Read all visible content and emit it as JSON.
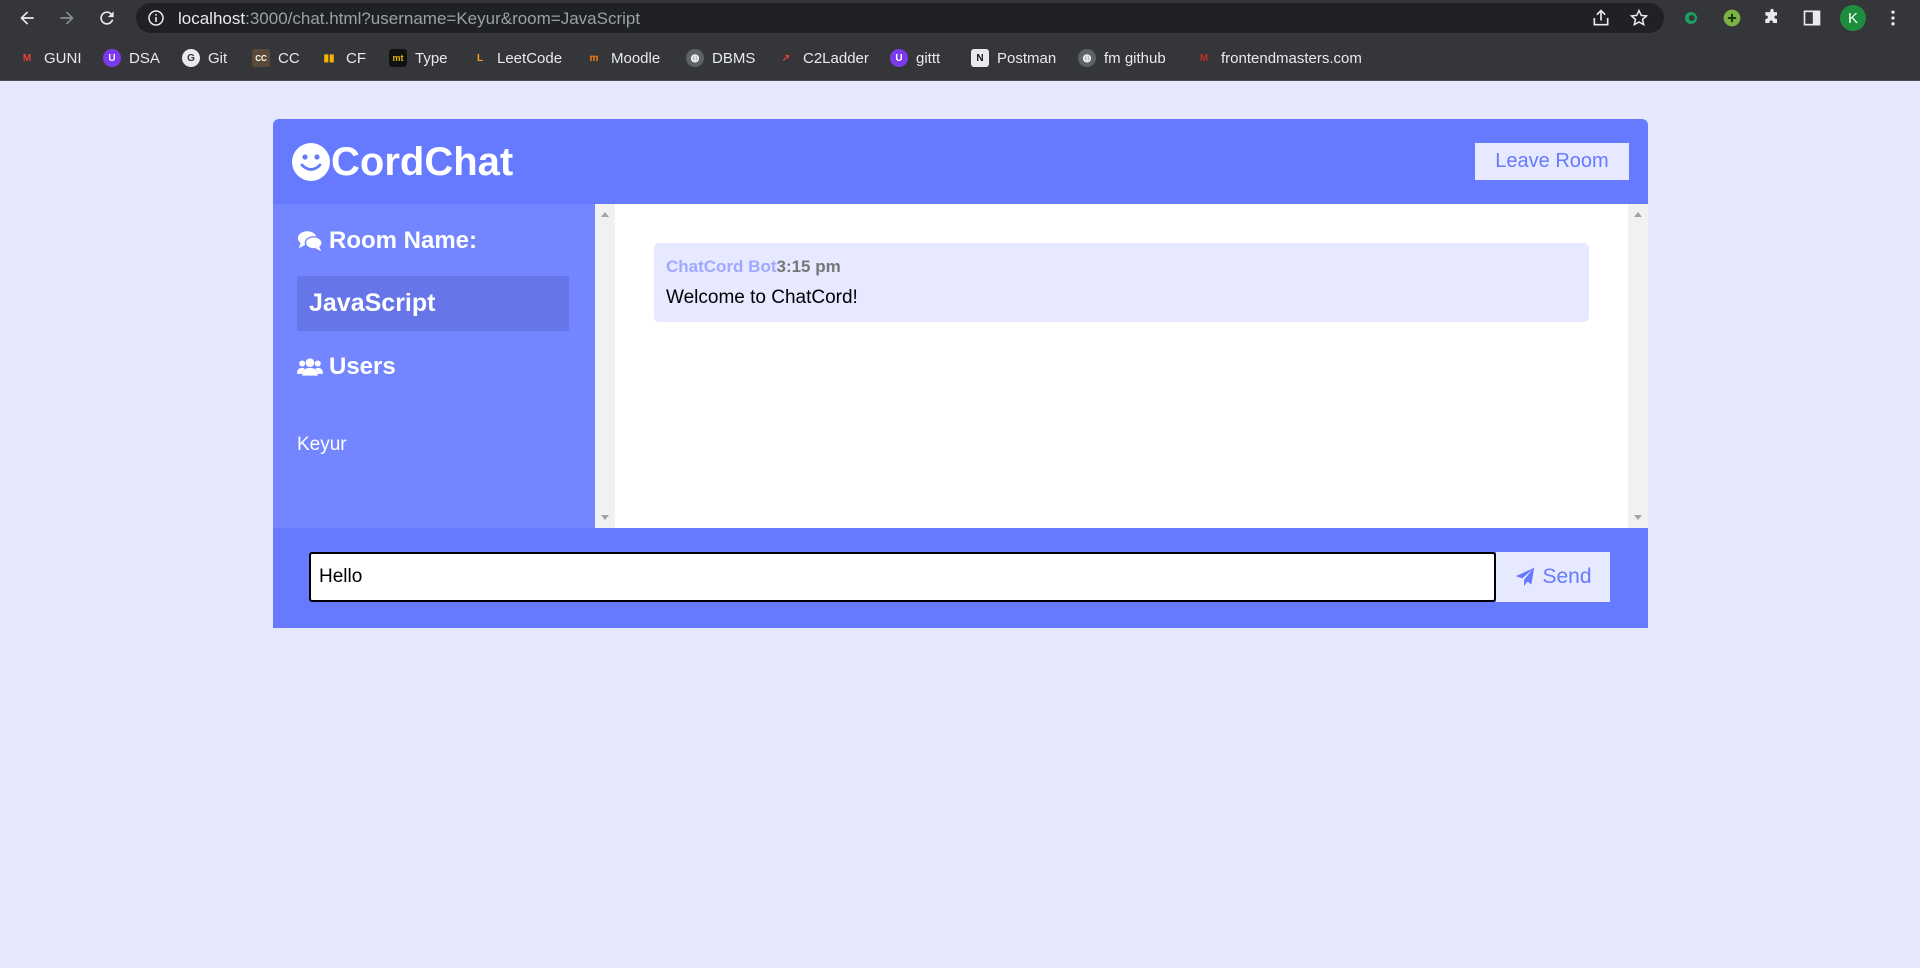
{
  "browser": {
    "url_host": "localhost",
    "url_rest": ":3000/chat.html?username=Keyur&room=JavaScript",
    "profile_initial": "K",
    "bookmarks": [
      {
        "label": "GUNI",
        "color": "#ea4335",
        "glyph": "M"
      },
      {
        "label": "DSA",
        "color": "#7c3aed",
        "glyph": "U"
      },
      {
        "label": "Git",
        "color": "#35363a",
        "glyph": "G"
      },
      {
        "label": "CC",
        "color": "#5b4a3a",
        "glyph": "CC"
      },
      {
        "label": "CF",
        "color": "#1a73e8",
        "glyph": "▮"
      },
      {
        "label": "Type",
        "color": "#111111",
        "glyph": "mt"
      },
      {
        "label": "LeetCode",
        "color": "#35363a",
        "glyph": "L"
      },
      {
        "label": "Moodle",
        "color": "#f98012",
        "glyph": "m"
      },
      {
        "label": "DBMS",
        "color": "#5f6368",
        "glyph": "◍"
      },
      {
        "label": "C2Ladder",
        "color": "#35363a",
        "glyph": "↗"
      },
      {
        "label": "gittt",
        "color": "#7c3aed",
        "glyph": "U"
      },
      {
        "label": "Postman",
        "color": "#111111",
        "glyph": "N"
      },
      {
        "label": "fm github",
        "color": "#5f6368",
        "glyph": "◍"
      },
      {
        "label": "frontendmasters.com",
        "color": "#c02d28",
        "glyph": "M"
      }
    ]
  },
  "header": {
    "logo_text": "CordChat",
    "leave_label": "Leave Room"
  },
  "sidebar": {
    "room_title": "Room Name:",
    "room_name": "JavaScript",
    "users_title": "Users",
    "users": [
      "Keyur"
    ]
  },
  "messages": [
    {
      "user": "ChatCord Bot",
      "time": "3:15 pm",
      "text": "Welcome to ChatCord!"
    }
  ],
  "form": {
    "input_value": "Hello",
    "send_label": "Send"
  },
  "colors": {
    "primary": "#667aff",
    "sidebar": "#7386ff",
    "light": "#e6e9ff"
  }
}
